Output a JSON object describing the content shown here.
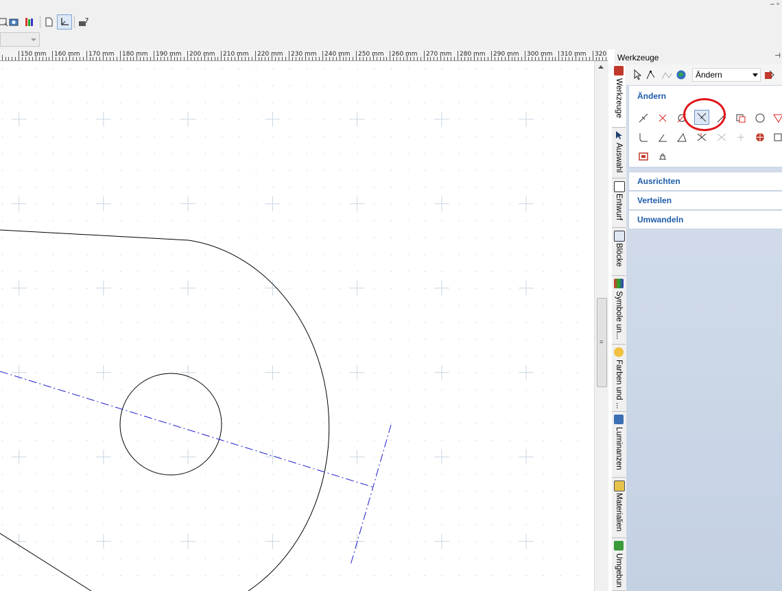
{
  "window": {
    "controls": "– ▫"
  },
  "ruler": {
    "unit": "mm",
    "labels": [
      "mm",
      "150 mm",
      "160 mm",
      "170 mm",
      "180 mm",
      "190 mm",
      "200 mm",
      "210 mm",
      "220 mm",
      "230 mm",
      "240 mm",
      "250 mm",
      "260 mm",
      "270 mm",
      "280 mm",
      "290 mm",
      "300 mm",
      "310 mm",
      "320"
    ]
  },
  "panel": {
    "title": "Werkzeuge",
    "pin": "⊣"
  },
  "side_tabs": [
    {
      "label": "Werkzeuge",
      "icon": "tools-icon"
    },
    {
      "label": "Auswahl",
      "icon": "selection-icon"
    },
    {
      "label": "Entwurf",
      "icon": "draft-icon"
    },
    {
      "label": "Blöcke",
      "icon": "blocks-icon"
    },
    {
      "label": "Symbole un...",
      "icon": "symbols-icon"
    },
    {
      "label": "Farben und ...",
      "icon": "colors-icon"
    },
    {
      "label": "Luminanzen",
      "icon": "luminance-icon"
    },
    {
      "label": "Materialien",
      "icon": "materials-icon"
    },
    {
      "label": "Umgebun",
      "icon": "environment-icon"
    }
  ],
  "toolpanel": {
    "category_select": "Ändern",
    "groups": {
      "aendern": "Ändern",
      "ausrichten": "Ausrichten",
      "verteilen": "Verteilen",
      "umwandeln": "Umwandeln"
    }
  },
  "accent": "#1e5ca8",
  "highlight_color": "#e0151b",
  "drawing_colors": {
    "geometry": "#000000",
    "axis": "#1a1acc",
    "grid": "#a9bccd"
  }
}
